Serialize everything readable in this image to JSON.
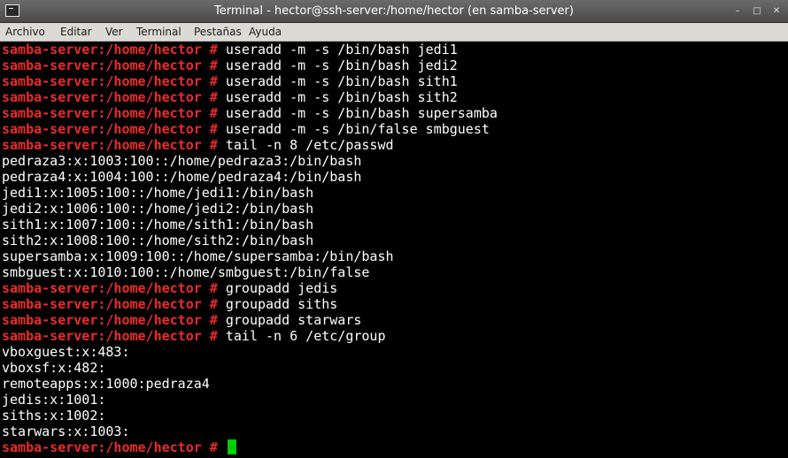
{
  "window": {
    "title": "Terminal - hector@ssh-server:/home/hector (en samba-server)",
    "controls": [
      "–",
      "□",
      "✕"
    ]
  },
  "menu": {
    "archivo": "Archivo",
    "editar": "Editar",
    "ver": "Ver",
    "terminal": "Terminal",
    "pestanas": "Pestañas",
    "ayuda": "Ayuda"
  },
  "colors": {
    "prompt": "#ef2929",
    "cursor": "#00cc00",
    "background": "#000000",
    "text": "#ffffff"
  },
  "terminal": {
    "prompt": "samba-server:/home/hector #",
    "lines": [
      {
        "type": "cmd",
        "text": "useradd -m -s /bin/bash jedi1"
      },
      {
        "type": "cmd",
        "text": "useradd -m -s /bin/bash jedi2"
      },
      {
        "type": "cmd",
        "text": "useradd -m -s /bin/bash sith1"
      },
      {
        "type": "cmd",
        "text": "useradd -m -s /bin/bash sith2"
      },
      {
        "type": "cmd",
        "text": "useradd -m -s /bin/bash supersamba"
      },
      {
        "type": "cmd",
        "text": "useradd -m -s /bin/false smbguest"
      },
      {
        "type": "cmd",
        "text": "tail -n 8 /etc/passwd"
      },
      {
        "type": "out",
        "text": "pedraza3:x:1003:100::/home/pedraza3:/bin/bash"
      },
      {
        "type": "out",
        "text": "pedraza4:x:1004:100::/home/pedraza4:/bin/bash"
      },
      {
        "type": "out",
        "text": "jedi1:x:1005:100::/home/jedi1:/bin/bash"
      },
      {
        "type": "out",
        "text": "jedi2:x:1006:100::/home/jedi2:/bin/bash"
      },
      {
        "type": "out",
        "text": "sith1:x:1007:100::/home/sith1:/bin/bash"
      },
      {
        "type": "out",
        "text": "sith2:x:1008:100::/home/sith2:/bin/bash"
      },
      {
        "type": "out",
        "text": "supersamba:x:1009:100::/home/supersamba:/bin/bash"
      },
      {
        "type": "out",
        "text": "smbguest:x:1010:100::/home/smbguest:/bin/false"
      },
      {
        "type": "cmd",
        "text": "groupadd jedis"
      },
      {
        "type": "cmd",
        "text": "groupadd siths"
      },
      {
        "type": "cmd",
        "text": "groupadd starwars"
      },
      {
        "type": "cmd",
        "text": "tail -n 6 /etc/group"
      },
      {
        "type": "out",
        "text": "vboxguest:x:483:"
      },
      {
        "type": "out",
        "text": "vboxsf:x:482:"
      },
      {
        "type": "out",
        "text": "remoteapps:x:1000:pedraza4"
      },
      {
        "type": "out",
        "text": "jedis:x:1001:"
      },
      {
        "type": "out",
        "text": "siths:x:1002:"
      },
      {
        "type": "out",
        "text": "starwars:x:1003:"
      },
      {
        "type": "prompt-only",
        "text": ""
      }
    ]
  }
}
